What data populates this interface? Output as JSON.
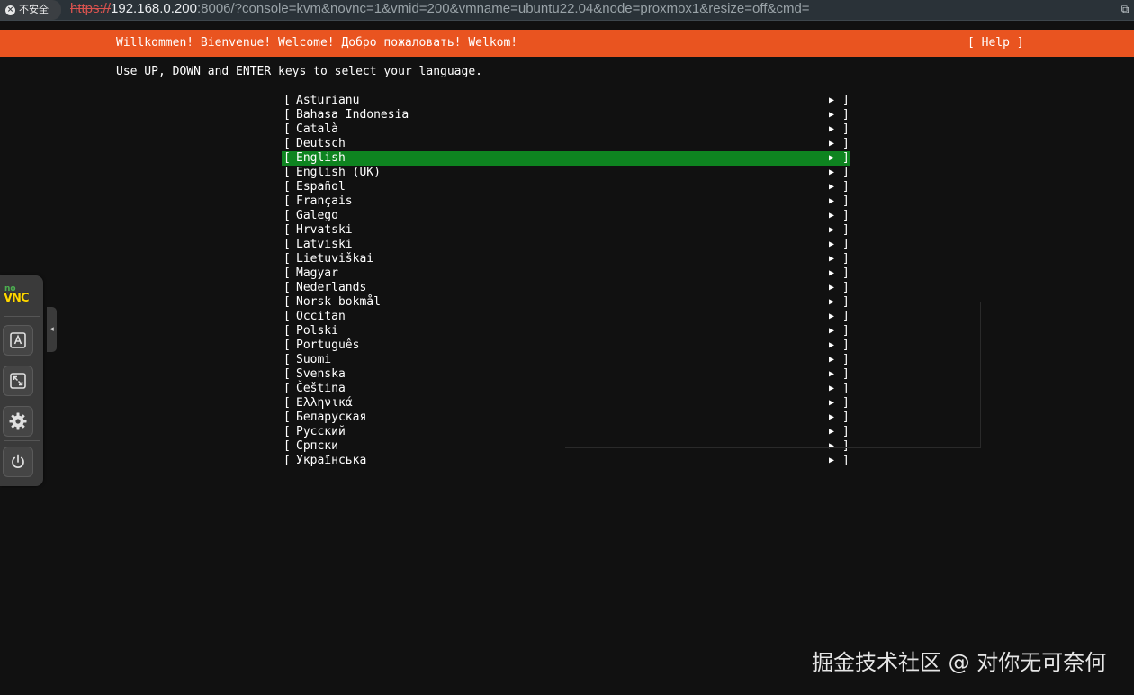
{
  "browser": {
    "security_label": "不安全",
    "url_protocol": "https://",
    "url_host": "192.168.0.200",
    "url_rest": ":8006/?console=kvm&novnc=1&vmid=200&vmname=ubuntu22.04&node=proxmox1&resize=off&cmd="
  },
  "header": {
    "welcome": "Willkommen! Bienvenue! Welcome! Добро пожаловать! Welkom!",
    "help": "[ Help ]"
  },
  "instructions": "Use UP, DOWN and ENTER keys to select your language.",
  "languages": {
    "selected": "English",
    "left_bracket": "[",
    "right_bracket": "]",
    "arrow": "▶",
    "items": [
      "Asturianu",
      "Bahasa Indonesia",
      "Català",
      "Deutsch",
      "English",
      "English (UK)",
      "Español",
      "Français",
      "Galego",
      "Hrvatski",
      "Latviski",
      "Lietuviškai",
      "Magyar",
      "Nederlands",
      "Norsk bokmål",
      "Occitan",
      "Polski",
      "Português",
      "Suomi",
      "Svenska",
      "Čeština",
      "Ελληνικά",
      "Беларуская",
      "Русский",
      "Српски",
      "Українська"
    ]
  },
  "novnc": {
    "logo_no": "no",
    "logo_vnc": "VNC",
    "buttons": [
      {
        "name": "extra-keys",
        "icon": "keyboard-a-icon"
      },
      {
        "name": "fullscreen",
        "icon": "fullscreen-icon"
      },
      {
        "name": "settings",
        "icon": "gear-icon"
      },
      {
        "name": "power",
        "icon": "power-icon"
      }
    ],
    "handle_arrow": "◂"
  },
  "watermark": "掘金技术社区 @ 对你无可奈何",
  "colors": {
    "header_bg": "#e95420",
    "selected_bg": "#0e8420",
    "screen_bg": "#111111"
  }
}
